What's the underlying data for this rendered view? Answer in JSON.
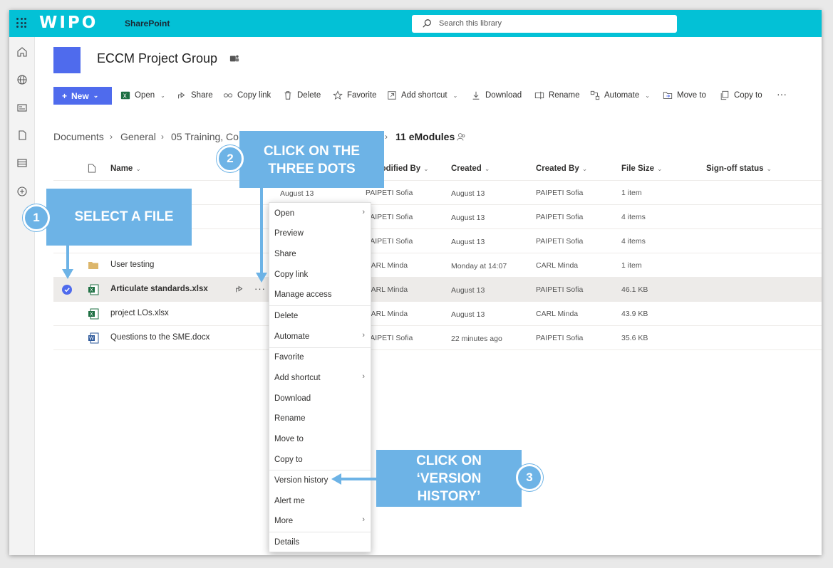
{
  "topbar": {
    "logo": "WIPO",
    "app_name": "SharePoint",
    "search_placeholder": "Search this library"
  },
  "site": {
    "title": "ECCM Project Group"
  },
  "commandbar": {
    "new_label": "New",
    "open_label": "Open",
    "share_label": "Share",
    "copylink_label": "Copy link",
    "delete_label": "Delete",
    "favorite_label": "Favorite",
    "addshortcut_label": "Add shortcut",
    "download_label": "Download",
    "rename_label": "Rename",
    "automate_label": "Automate",
    "moveto_label": "Move to",
    "copyto_label": "Copy to",
    "more_label": "···"
  },
  "breadcrumb": {
    "items": [
      "Documents",
      "General",
      "05 Training, Co",
      "11 eModules"
    ]
  },
  "table": {
    "headers": {
      "name": "Name",
      "modified_by": "Modified By",
      "created": "Created",
      "created_by": "Created By",
      "file_size": "File Size",
      "signoff": "Sign-off status"
    },
    "rows": [
      {
        "name": "",
        "modified": "August 13",
        "modified_by": "PAIPETI Sofia",
        "created": "August 13",
        "created_by": "PAIPETI Sofia",
        "size": "1 item",
        "type": "folder"
      },
      {
        "name": "",
        "modified": "",
        "modified_by": "PAIPETI Sofia",
        "created": "August 13",
        "created_by": "PAIPETI Sofia",
        "size": "4 items",
        "type": "folder"
      },
      {
        "name": "",
        "modified": "",
        "modified_by": "PAIPETI Sofia",
        "created": "August 13",
        "created_by": "PAIPETI Sofia",
        "size": "4 items",
        "type": "folder"
      },
      {
        "name": "User testing",
        "modified": "",
        "modified_by": "CARL Minda",
        "created": "Monday at 14:07",
        "created_by": "CARL Minda",
        "size": "1 item",
        "type": "folder"
      },
      {
        "name": "Articulate standards.xlsx",
        "modified": "",
        "modified_by": "CARL Minda",
        "created": "August 13",
        "created_by": "PAIPETI Sofia",
        "size": "46.1 KB",
        "type": "excel"
      },
      {
        "name": "project LOs.xlsx",
        "modified": "",
        "modified_by": "CARL Minda",
        "created": "August 13",
        "created_by": "CARL Minda",
        "size": "43.9 KB",
        "type": "excel"
      },
      {
        "name": "Questions to the SME.docx",
        "modified": "",
        "modified_by": "PAIPETI Sofia",
        "created": "22 minutes ago",
        "created_by": "PAIPETI Sofia",
        "size": "35.6 KB",
        "type": "word"
      }
    ]
  },
  "context_menu": {
    "items": [
      "Open",
      "Preview",
      "Share",
      "Copy link",
      "Manage access",
      "Delete",
      "Automate",
      "Favorite",
      "Add shortcut",
      "Download",
      "Rename",
      "Move to",
      "Copy to",
      "Version history",
      "Alert me",
      "More",
      "Details"
    ]
  },
  "callouts": {
    "step1_number": "1",
    "step1_text": "SELECT A FILE",
    "step2_number": "2",
    "step2_line1": "CLICK ON THE",
    "step2_line2": "THREE DOTS",
    "step3_number": "3",
    "step3_line1": "CLICK ON",
    "step3_line2": "‘VERSION",
    "step3_line3": "HISTORY’"
  },
  "colors": {
    "topbar": "#03c1d6",
    "accent": "#4f6bed",
    "callout": "#6db3e6"
  }
}
